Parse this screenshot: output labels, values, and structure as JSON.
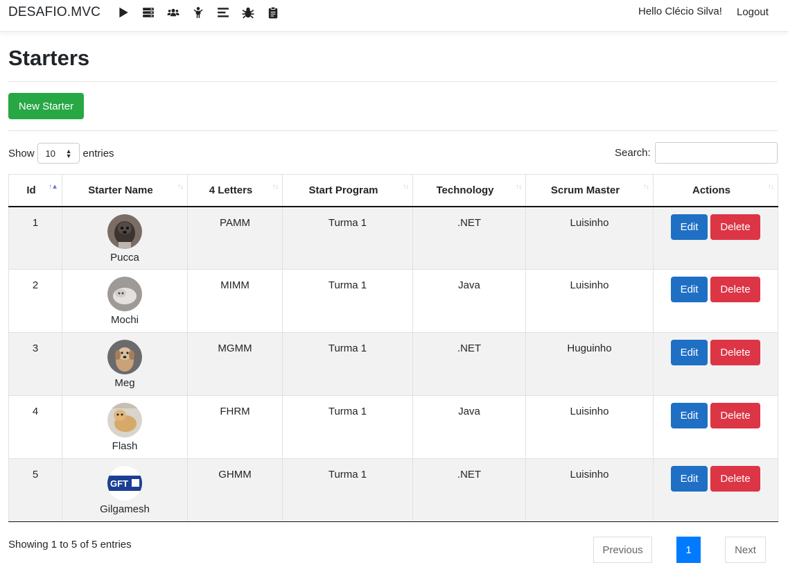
{
  "nav": {
    "brand": "DESAFIO.MVC",
    "icons": [
      "play-icon",
      "server-icon",
      "users-icon",
      "child-icon",
      "list-icon",
      "bug-icon",
      "clipboard-icon"
    ],
    "greeting": "Hello Clécio Silva!",
    "logout": "Logout"
  },
  "page": {
    "title": "Starters",
    "new_button": "New Starter"
  },
  "table_controls": {
    "show_label": "Show",
    "entries_label": "entries",
    "page_size": "10",
    "search_label": "Search:",
    "search_value": ""
  },
  "table": {
    "columns": [
      "Id",
      "Starter Name",
      "4 Letters",
      "Start Program",
      "Technology",
      "Scrum Master",
      "Actions"
    ],
    "sorted_column": "Id",
    "rows": [
      {
        "id": "1",
        "name": "Pucca",
        "letters": "PAMM",
        "program": "Turma 1",
        "tech": ".NET",
        "master": "Luisinho",
        "avatar": "dog-photo-dark"
      },
      {
        "id": "2",
        "name": "Mochi",
        "letters": "MIMM",
        "program": "Turma 1",
        "tech": "Java",
        "master": "Luisinho",
        "avatar": "dog-photo-white"
      },
      {
        "id": "3",
        "name": "Meg",
        "letters": "MGMM",
        "program": "Turma 1",
        "tech": ".NET",
        "master": "Huguinho",
        "avatar": "dog-photo-tan"
      },
      {
        "id": "4",
        "name": "Flash",
        "letters": "FHRM",
        "program": "Turma 1",
        "tech": "Java",
        "master": "Luisinho",
        "avatar": "dog-photo-golden"
      },
      {
        "id": "5",
        "name": "Gilgamesh",
        "letters": "GHMM",
        "program": "Turma 1",
        "tech": ".NET",
        "master": "Luisinho",
        "avatar": "gft-logo"
      }
    ],
    "edit_label": "Edit",
    "delete_label": "Delete"
  },
  "footer": {
    "info": "Showing 1 to 5 of 5 entries",
    "prev": "Previous",
    "current_page": "1",
    "next": "Next"
  },
  "colors": {
    "new_button": "#28a745",
    "edit_button": "#1f6fc5",
    "delete_button": "#dc3545",
    "active_page": "#007bff",
    "striped_row": "#f2f2f2"
  }
}
